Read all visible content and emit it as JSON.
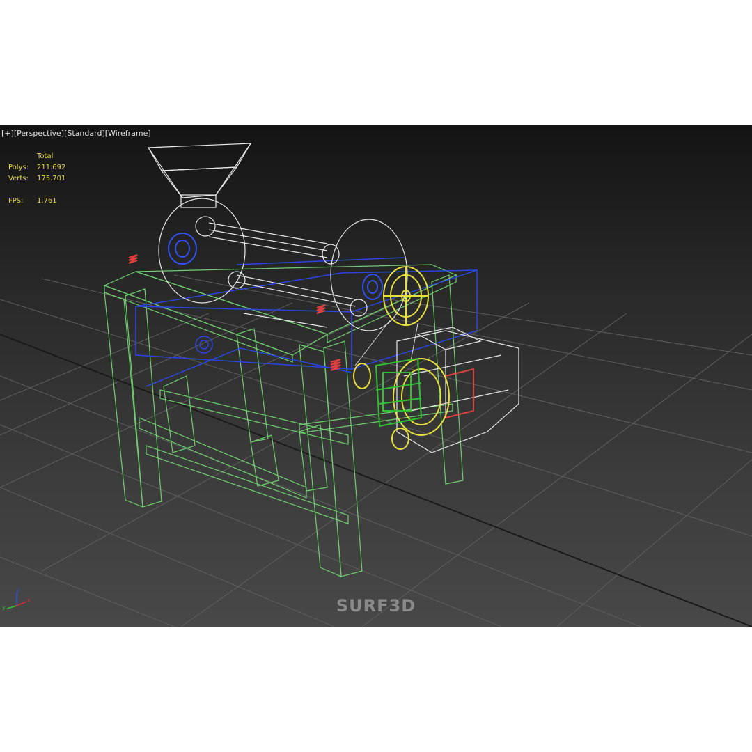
{
  "viewport": {
    "labels": [
      "[+]",
      "[Perspective]",
      "[Standard]",
      "[Wireframe]"
    ],
    "stats": {
      "header": "Total",
      "polys_label": "Polys:",
      "polys_value": "211.692",
      "verts_label": "Verts:",
      "verts_value": "175.701",
      "fps_label": "FPS:",
      "fps_value": "1,761"
    },
    "watermark": "SURF3D"
  },
  "axis_gizmo": {
    "x_label": "x",
    "y_label": "y",
    "z_label": "z",
    "colors": {
      "x": "#d03030",
      "y": "#30c030",
      "z": "#3050e0"
    }
  },
  "colors": {
    "frame": "#6fcf6f",
    "housing": "#2b45e0",
    "drum": "#e8e8e8",
    "pulley": "#e8e040",
    "motor": "#30c030",
    "spring": "#e04040",
    "grid": "#6a6a6a"
  },
  "icons": [
    "axis-gizmo-icon"
  ]
}
